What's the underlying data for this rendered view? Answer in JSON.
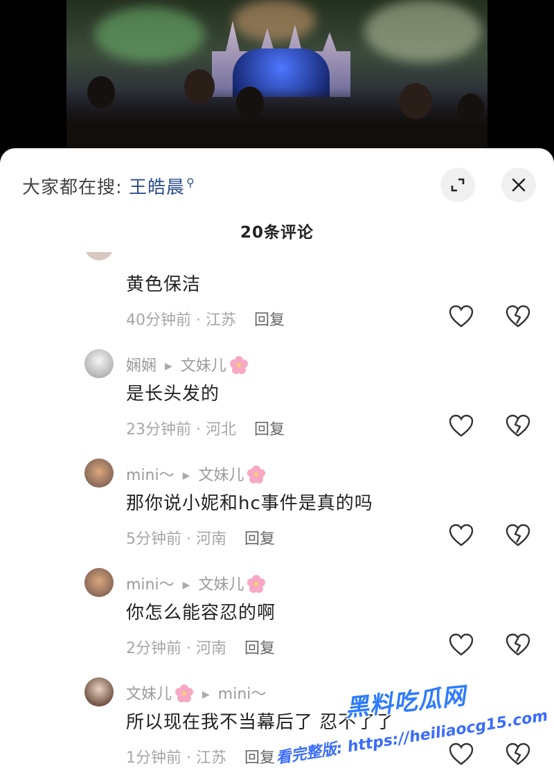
{
  "search": {
    "label": "大家都在搜:",
    "keyword": "王皓晨"
  },
  "header": {
    "comment_count": "20条评论"
  },
  "comments": [
    {
      "text": "黄色保洁",
      "time_loc": "40分钟前 · 江苏",
      "reply": "回复"
    },
    {
      "user": "娴娴",
      "reply_to": "文妹儿",
      "text": "是长头发的",
      "time_loc": "23分钟前 · 河北",
      "reply": "回复"
    },
    {
      "user": "mini～",
      "reply_to": "文妹儿",
      "text": "那你说小妮和hc事件是真的吗",
      "time_loc": "5分钟前 · 河南",
      "reply": "回复"
    },
    {
      "user": "mini～",
      "reply_to": "文妹儿",
      "text": "你怎么能容忍的啊",
      "time_loc": "2分钟前 · 河南",
      "reply": "回复"
    },
    {
      "user": "文妹儿",
      "reply_to": "mini～",
      "text": "所以现在我不当幕后了 忍不了了",
      "time_loc": "1分钟前 · 江苏",
      "reply": "回复"
    }
  ],
  "watermark": {
    "brand": "黑料吃瓜网",
    "line": "看完整版: https://heiliaocg15.com"
  },
  "colors": {
    "keyword": "#2c4e8f",
    "watermark": "#2d7bff"
  }
}
